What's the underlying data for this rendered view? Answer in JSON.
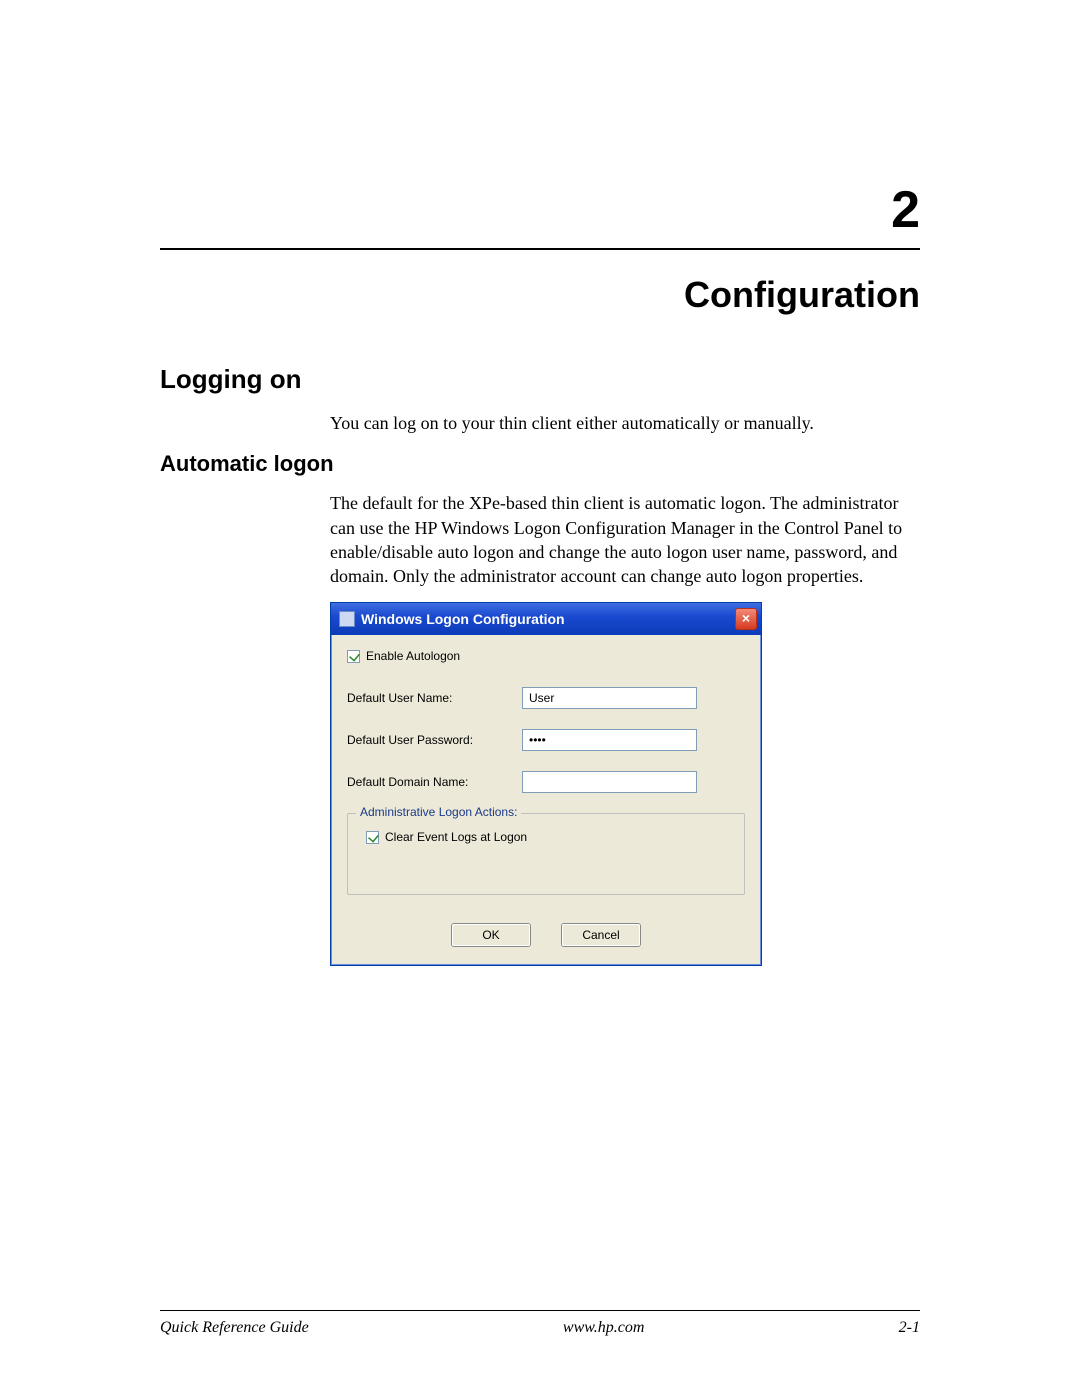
{
  "chapter": {
    "number": "2",
    "title": "Configuration"
  },
  "section": {
    "h2": "Logging on",
    "intro": "You can log on to your thin client either automatically or manually.",
    "h3": "Automatic logon",
    "body": "The default for the XPe-based thin client is automatic logon. The administrator can use the HP Windows Logon Configuration Manager in the Control Panel to enable/disable auto logon and change the auto logon user name, password, and domain. Only the administrator account can change auto logon properties."
  },
  "dialog": {
    "title": "Windows Logon Configuration",
    "close_glyph": "×",
    "enable_autologon_label": "Enable Autologon",
    "username_label": "Default User Name:",
    "username_value": "User",
    "password_label": "Default User Password:",
    "password_value": "••••",
    "domain_label": "Default Domain Name:",
    "domain_value": "",
    "group_label": "Administrative Logon Actions:",
    "clear_logs_label": "Clear Event Logs at Logon",
    "ok": "OK",
    "cancel": "Cancel"
  },
  "footer": {
    "left": "Quick Reference Guide",
    "center": "www.hp.com",
    "right": "2-1"
  }
}
